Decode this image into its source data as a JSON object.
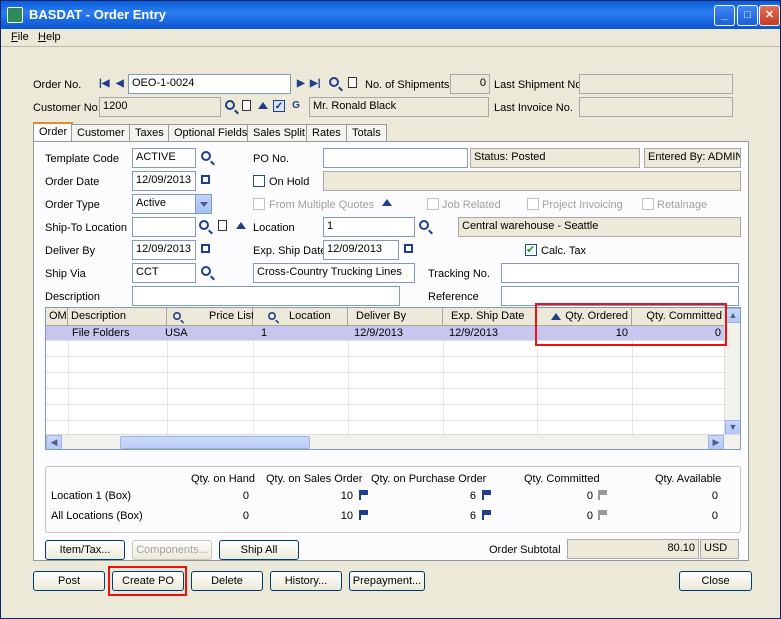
{
  "window": {
    "title": "BASDAT - Order Entry"
  },
  "menu": {
    "file": "File",
    "help": "Help"
  },
  "header": {
    "order_no_label": "Order No.",
    "order_no": "OEO-1-0024",
    "no_of_shipments_label": "No. of Shipments",
    "no_of_shipments": "0",
    "last_shipment_label": "Last Shipment No.",
    "last_shipment": "",
    "customer_no_label": "Customer No.",
    "customer_no": "1200",
    "customer_name": "Mr. Ronald Black",
    "last_invoice_label": "Last Invoice No.",
    "last_invoice": ""
  },
  "tabs": [
    {
      "label": "Order"
    },
    {
      "label": "Customer"
    },
    {
      "label": "Taxes"
    },
    {
      "label": "Optional Fields"
    },
    {
      "label": "Sales Split"
    },
    {
      "label": "Rates"
    },
    {
      "label": "Totals"
    }
  ],
  "order": {
    "template_code_label": "Template Code",
    "template_code": "ACTIVE",
    "po_no_label": "PO No.",
    "po_no": "",
    "status": "Status: Posted",
    "entered_by": "Entered By: ADMIN",
    "order_date_label": "Order Date",
    "order_date": "12/09/2013",
    "on_hold_label": "On Hold",
    "order_type_label": "Order Type",
    "order_type": "Active",
    "from_multiple_quotes_label": "From Multiple Quotes",
    "job_related_label": "Job Related",
    "project_invoicing_label": "Project Invoicing",
    "retainage_label": "Retainage",
    "ship_to_label": "Ship-To Location",
    "ship_to": "",
    "location_label": "Location",
    "location": "1",
    "location_desc": "Central warehouse - Seattle",
    "deliver_by_label": "Deliver By",
    "deliver_by": "12/09/2013",
    "exp_ship_date_label": "Exp. Ship Date",
    "exp_ship_date": "12/09/2013",
    "calc_tax_label": "Calc. Tax",
    "ship_via_label": "Ship Via",
    "ship_via": "CCT",
    "ship_via_desc": "Cross-Country Trucking Lines",
    "tracking_no_label": "Tracking No.",
    "tracking_no": "",
    "description_label": "Description",
    "description": "",
    "reference_label": "Reference",
    "reference": ""
  },
  "grid": {
    "columns": [
      "OM",
      "Description",
      "Price List",
      "Location",
      "Deliver By",
      "Exp. Ship Date",
      "Qty. Ordered",
      "Qty. Committed"
    ],
    "rows": [
      {
        "om": "",
        "description": "File Folders",
        "price_list": "USA",
        "location": "1",
        "deliver_by": "12/9/2013",
        "exp_ship_date": "12/9/2013",
        "qty_ordered": "10",
        "qty_committed": "0"
      }
    ]
  },
  "qty": {
    "headers": [
      "Qty. on Hand",
      "Qty. on Sales Order",
      "Qty. on Purchase Order",
      "Qty. Committed",
      "Qty. Available"
    ],
    "rows": [
      {
        "label": "Location  1 (Box)",
        "on_hand": "0",
        "on_sales": "10",
        "on_po": "6",
        "committed": "0",
        "available": "0"
      },
      {
        "label": "All Locations (Box)",
        "on_hand": "0",
        "on_sales": "10",
        "on_po": "6",
        "committed": "0",
        "available": "0"
      }
    ]
  },
  "buttons": {
    "item_tax": "Item/Tax...",
    "components": "Components...",
    "ship_all": "Ship All",
    "post": "Post",
    "create_po": "Create PO",
    "delete": "Delete",
    "history": "History...",
    "prepayment": "Prepayment...",
    "close": "Close"
  },
  "totals": {
    "order_subtotal_label": "Order Subtotal",
    "order_subtotal": "80.10",
    "currency": "USD"
  },
  "colors": {
    "title_bar": "#0a5fd8",
    "highlight_box": "#e11111",
    "selected_row": "#c7c6ef"
  }
}
